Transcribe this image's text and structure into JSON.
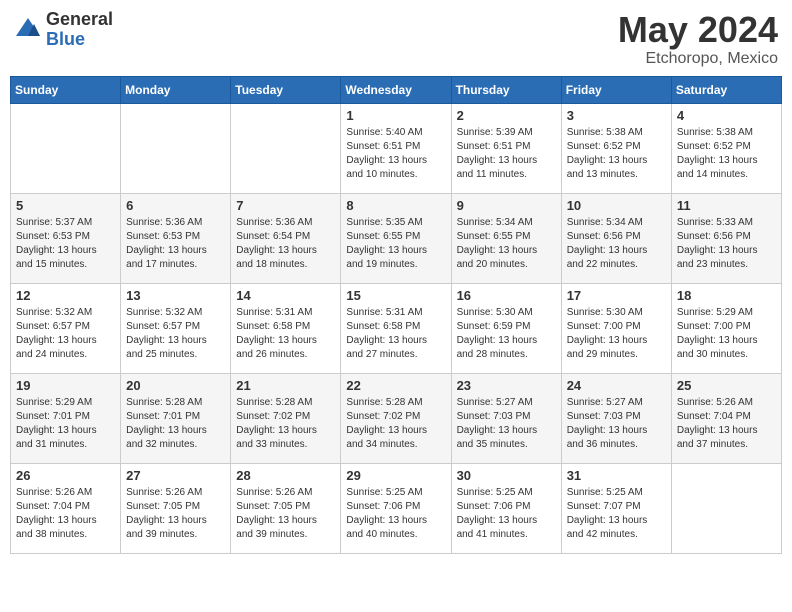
{
  "header": {
    "logo_general": "General",
    "logo_blue": "Blue",
    "month_title": "May 2024",
    "location": "Etchoropo, Mexico"
  },
  "days_of_week": [
    "Sunday",
    "Monday",
    "Tuesday",
    "Wednesday",
    "Thursday",
    "Friday",
    "Saturday"
  ],
  "weeks": [
    [
      {
        "day": "",
        "info": ""
      },
      {
        "day": "",
        "info": ""
      },
      {
        "day": "",
        "info": ""
      },
      {
        "day": "1",
        "info": "Sunrise: 5:40 AM\nSunset: 6:51 PM\nDaylight: 13 hours\nand 10 minutes."
      },
      {
        "day": "2",
        "info": "Sunrise: 5:39 AM\nSunset: 6:51 PM\nDaylight: 13 hours\nand 11 minutes."
      },
      {
        "day": "3",
        "info": "Sunrise: 5:38 AM\nSunset: 6:52 PM\nDaylight: 13 hours\nand 13 minutes."
      },
      {
        "day": "4",
        "info": "Sunrise: 5:38 AM\nSunset: 6:52 PM\nDaylight: 13 hours\nand 14 minutes."
      }
    ],
    [
      {
        "day": "5",
        "info": "Sunrise: 5:37 AM\nSunset: 6:53 PM\nDaylight: 13 hours\nand 15 minutes."
      },
      {
        "day": "6",
        "info": "Sunrise: 5:36 AM\nSunset: 6:53 PM\nDaylight: 13 hours\nand 17 minutes."
      },
      {
        "day": "7",
        "info": "Sunrise: 5:36 AM\nSunset: 6:54 PM\nDaylight: 13 hours\nand 18 minutes."
      },
      {
        "day": "8",
        "info": "Sunrise: 5:35 AM\nSunset: 6:55 PM\nDaylight: 13 hours\nand 19 minutes."
      },
      {
        "day": "9",
        "info": "Sunrise: 5:34 AM\nSunset: 6:55 PM\nDaylight: 13 hours\nand 20 minutes."
      },
      {
        "day": "10",
        "info": "Sunrise: 5:34 AM\nSunset: 6:56 PM\nDaylight: 13 hours\nand 22 minutes."
      },
      {
        "day": "11",
        "info": "Sunrise: 5:33 AM\nSunset: 6:56 PM\nDaylight: 13 hours\nand 23 minutes."
      }
    ],
    [
      {
        "day": "12",
        "info": "Sunrise: 5:32 AM\nSunset: 6:57 PM\nDaylight: 13 hours\nand 24 minutes."
      },
      {
        "day": "13",
        "info": "Sunrise: 5:32 AM\nSunset: 6:57 PM\nDaylight: 13 hours\nand 25 minutes."
      },
      {
        "day": "14",
        "info": "Sunrise: 5:31 AM\nSunset: 6:58 PM\nDaylight: 13 hours\nand 26 minutes."
      },
      {
        "day": "15",
        "info": "Sunrise: 5:31 AM\nSunset: 6:58 PM\nDaylight: 13 hours\nand 27 minutes."
      },
      {
        "day": "16",
        "info": "Sunrise: 5:30 AM\nSunset: 6:59 PM\nDaylight: 13 hours\nand 28 minutes."
      },
      {
        "day": "17",
        "info": "Sunrise: 5:30 AM\nSunset: 7:00 PM\nDaylight: 13 hours\nand 29 minutes."
      },
      {
        "day": "18",
        "info": "Sunrise: 5:29 AM\nSunset: 7:00 PM\nDaylight: 13 hours\nand 30 minutes."
      }
    ],
    [
      {
        "day": "19",
        "info": "Sunrise: 5:29 AM\nSunset: 7:01 PM\nDaylight: 13 hours\nand 31 minutes."
      },
      {
        "day": "20",
        "info": "Sunrise: 5:28 AM\nSunset: 7:01 PM\nDaylight: 13 hours\nand 32 minutes."
      },
      {
        "day": "21",
        "info": "Sunrise: 5:28 AM\nSunset: 7:02 PM\nDaylight: 13 hours\nand 33 minutes."
      },
      {
        "day": "22",
        "info": "Sunrise: 5:28 AM\nSunset: 7:02 PM\nDaylight: 13 hours\nand 34 minutes."
      },
      {
        "day": "23",
        "info": "Sunrise: 5:27 AM\nSunset: 7:03 PM\nDaylight: 13 hours\nand 35 minutes."
      },
      {
        "day": "24",
        "info": "Sunrise: 5:27 AM\nSunset: 7:03 PM\nDaylight: 13 hours\nand 36 minutes."
      },
      {
        "day": "25",
        "info": "Sunrise: 5:26 AM\nSunset: 7:04 PM\nDaylight: 13 hours\nand 37 minutes."
      }
    ],
    [
      {
        "day": "26",
        "info": "Sunrise: 5:26 AM\nSunset: 7:04 PM\nDaylight: 13 hours\nand 38 minutes."
      },
      {
        "day": "27",
        "info": "Sunrise: 5:26 AM\nSunset: 7:05 PM\nDaylight: 13 hours\nand 39 minutes."
      },
      {
        "day": "28",
        "info": "Sunrise: 5:26 AM\nSunset: 7:05 PM\nDaylight: 13 hours\nand 39 minutes."
      },
      {
        "day": "29",
        "info": "Sunrise: 5:25 AM\nSunset: 7:06 PM\nDaylight: 13 hours\nand 40 minutes."
      },
      {
        "day": "30",
        "info": "Sunrise: 5:25 AM\nSunset: 7:06 PM\nDaylight: 13 hours\nand 41 minutes."
      },
      {
        "day": "31",
        "info": "Sunrise: 5:25 AM\nSunset: 7:07 PM\nDaylight: 13 hours\nand 42 minutes."
      },
      {
        "day": "",
        "info": ""
      }
    ]
  ]
}
